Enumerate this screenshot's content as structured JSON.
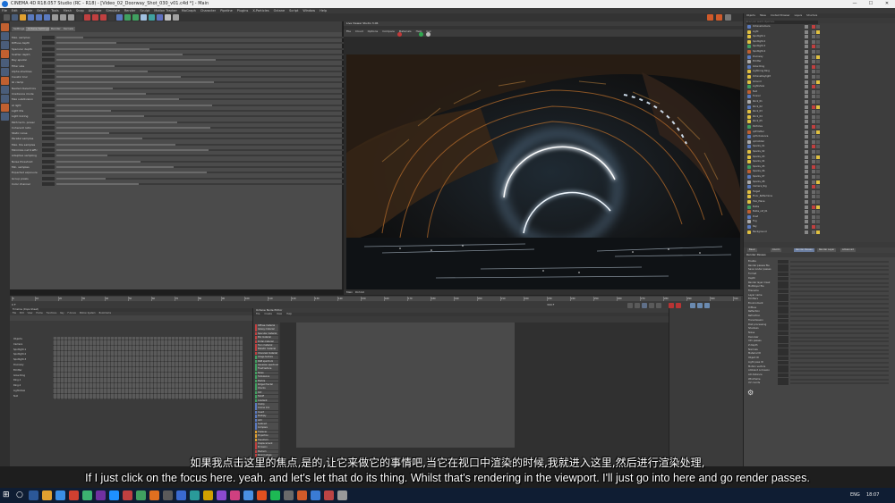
{
  "window": {
    "title": "CINEMA 4D R18.057 Studio (RC - R18) - [Video_02_Doorway_Shot_030_v01.c4d *] - Main",
    "controls": [
      "—",
      "☐",
      "✕"
    ]
  },
  "menubar": [
    "File",
    "Edit",
    "Create",
    "Select",
    "Tools",
    "Mesh",
    "Snap",
    "Animate",
    "Simulate",
    "Render",
    "Sculpt",
    "Motion Tracker",
    "MoGraph",
    "Character",
    "Pipeline",
    "Plugins",
    "X-Particles",
    "Octane",
    "Script",
    "Window",
    "Help"
  ],
  "colors": {
    "accent": "#1b6fd6",
    "ring_glow": "#dfeeff",
    "orange_particles": "#b36a2a",
    "octane_green": "#2fa84f"
  },
  "attributes": {
    "tabs": [
      "Settings",
      "Octane Settings",
      "Render",
      "Kernels"
    ],
    "params": [
      "Max. samples",
      "Diffuse depth",
      "Specular depth",
      "Scatter depth",
      "Ray epsilon",
      "Filter size",
      "Alpha shadows",
      "Caustic blur",
      "GI clamp",
      "Nested dielectrics",
      "Irradiance mode",
      "Max subdivision",
      "AI light",
      "Light IDs",
      "Light linking",
      "Path term. power",
      "Coherent ratio",
      "Static noise",
      "Parallel samples",
      "Max. tile samples",
      "Minimize net traffic",
      "Adaptive sampling",
      "Noise threshold",
      "Min. samples",
      "Expected exposure",
      "Group pixels",
      "Color channel"
    ]
  },
  "viewport": {
    "title": "Live Viewer Studio 3.06",
    "menu": [
      "File",
      "Cloud",
      "Options",
      "Compare",
      "Materials",
      "Help",
      "Gui"
    ],
    "status_left": "Main",
    "status_right": "DirtAO"
  },
  "object_manager": {
    "tabs": [
      "Objects",
      "Takes",
      "Content Browser",
      "Layers",
      "Structure"
    ],
    "search_placeholder": "Enter your search object here",
    "items": [
      "OctaneCamera",
      "Light",
      "Spotlight.1",
      "Spotlight.2",
      "Spotlight.3",
      "Spotlight.4",
      "Doorway",
      "Emitter",
      "Glow Ring",
      "Lightning Ring",
      "OctaneDaylight",
      "Ground",
      "Lightshow",
      "Null",
      "Tunnel",
      "Rock_01",
      "Rock_02",
      "Rock_03",
      "Rock_04",
      "Rock_05",
      "Particles",
      "xpEmitter",
      "xpTurbulence",
      "xpCollider",
      "Sparks_01",
      "Sparks_02",
      "Sparks_03",
      "Sparks_04",
      "Sparks_05",
      "Sparks_06",
      "Sparks_07",
      "Sparks_08",
      "Camera_Rig",
      "Target",
      "Floor_Reflections",
      "Hex_Plane",
      "Bulbs",
      "Bulbs_ref_01",
      "Dust",
      "Fog",
      "Sky",
      "Background"
    ]
  },
  "render_settings": {
    "tabs": [
      "Basic",
      "Coord.",
      "Render Passes",
      "Render Layer",
      "Advanced"
    ],
    "section": "Render Passes",
    "params": [
      "Enable",
      "Render passes file",
      "Save render passes",
      "Format",
      "Depth",
      "Render layer mask",
      "Multilayer file",
      "Filename",
      "Layer name",
      "Emitters",
      "Environment",
      "Diffuse",
      "Reflection",
      "Refraction",
      "Transmission",
      "Post processing",
      "Shadows",
      "Noise",
      "Denoiser",
      "Info passes",
      "Z-Depth",
      "Normals",
      "Material ID",
      "Object ID",
      "Light pass ID",
      "Motion vectors",
      "Ambient occlusion",
      "AO distance",
      "Wireframe",
      "UV coords"
    ]
  },
  "timeline": {
    "ticks": [
      "0",
      "10",
      "20",
      "30",
      "40",
      "50",
      "60",
      "70",
      "80",
      "90",
      "100",
      "110",
      "120",
      "130",
      "140",
      "150",
      "160",
      "170",
      "180",
      "190",
      "200",
      "210",
      "220",
      "230",
      "240",
      "250",
      "260",
      "270",
      "280",
      "290",
      "300",
      "310"
    ],
    "current_frame": "0 F",
    "end_frame": "300 F"
  },
  "timeline_manager": {
    "title": "Timeline (Dope Sheet)",
    "menu": [
      "File",
      "Edit",
      "View",
      "Frame",
      "Functions",
      "Key",
      "F-Curve",
      "Motion System",
      "Bookmarks"
    ],
    "rows": [
      "Objects",
      "Camera",
      "Spotlight.1",
      "Spotlight.2",
      "Spotlight.3",
      "Doorway",
      "Emitter",
      "Glow Ring",
      "Ring.1",
      "Ring.2",
      "Lightshow",
      "Null"
    ]
  },
  "node_editor": {
    "title": "Octane Node Editor",
    "menu": [
      "File",
      "Create",
      "View",
      "Help"
    ],
    "items": [
      "Diffuse material",
      "Glossy material",
      "Specular material",
      "Mix material",
      "Portal material",
      "Toon material",
      "Metallic material",
      "Universal material",
      "Image texture",
      "RGB spectrum",
      "Gaussian spectrum",
      "Float texture",
      "Noise",
      "Turbulence",
      "Marble",
      "Ridged fractal",
      "Checks",
      "Dirt",
      "Falloff",
      "Gradient",
      "Clamp",
      "Cosine mix",
      "Invert",
      "Multiply",
      "Add",
      "Subtract",
      "Compare",
      "Triplanar",
      "Projection",
      "Transform",
      "Displacement",
      "Emission",
      "Medium",
      "Round edges"
    ]
  },
  "subtitles": {
    "zh": "如果我点击这里的焦点,是的,让它来做它的事情吧,当它在视口中渲染的时候,我就进入这里,然后进行渲染处理,",
    "en": "If I just click on the focus here. yeah. and let's let that do its thing. Whilst that's rendering in the viewport. I'll just go into here and go render passes."
  },
  "taskbar": {
    "tray": [
      "ENG",
      "18:07"
    ]
  }
}
